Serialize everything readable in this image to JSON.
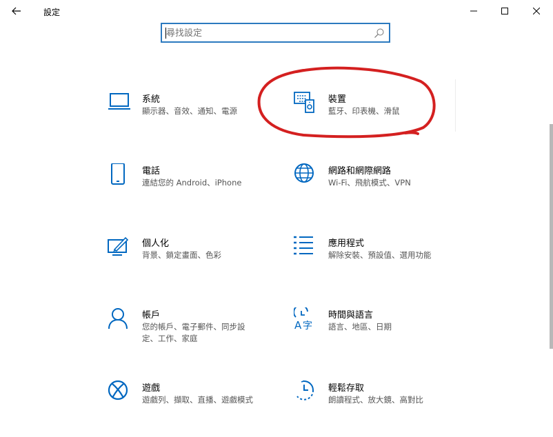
{
  "window": {
    "title": "設定"
  },
  "search": {
    "placeholder": "尋找設定"
  },
  "categories": [
    {
      "title": "系統",
      "description": "顯示器、音效、通知、電源",
      "icon": "laptop-icon"
    },
    {
      "title": "裝置",
      "description": "藍牙、印表機、滑鼠",
      "icon": "devices-icon"
    },
    {
      "title": "電話",
      "description": "連結您的 Android、iPhone",
      "icon": "phone-icon"
    },
    {
      "title": "網路和網際網路",
      "description": "Wi-Fi、飛航模式、VPN",
      "icon": "globe-icon"
    },
    {
      "title": "個人化",
      "description": "背景、鎖定畫面、色彩",
      "icon": "personalization-icon"
    },
    {
      "title": "應用程式",
      "description": "解除安裝、預設值、選用功能",
      "icon": "apps-list-icon"
    },
    {
      "title": "帳戶",
      "description": "您的帳戶、電子郵件、同步設定、工作、家庭",
      "icon": "person-icon"
    },
    {
      "title": "時間與語言",
      "description": "語言、地區、日期",
      "icon": "time-language-icon"
    },
    {
      "title": "遊戲",
      "description": "遊戲列、擷取、直播、遊戲模式",
      "icon": "xbox-icon"
    },
    {
      "title": "輕鬆存取",
      "description": "朗讀程式、放大鏡、高對比",
      "icon": "ease-of-access-icon"
    }
  ],
  "colors": {
    "accent": "#0067c0",
    "search_border": "#2b79bf",
    "annotation": "#d42020"
  }
}
